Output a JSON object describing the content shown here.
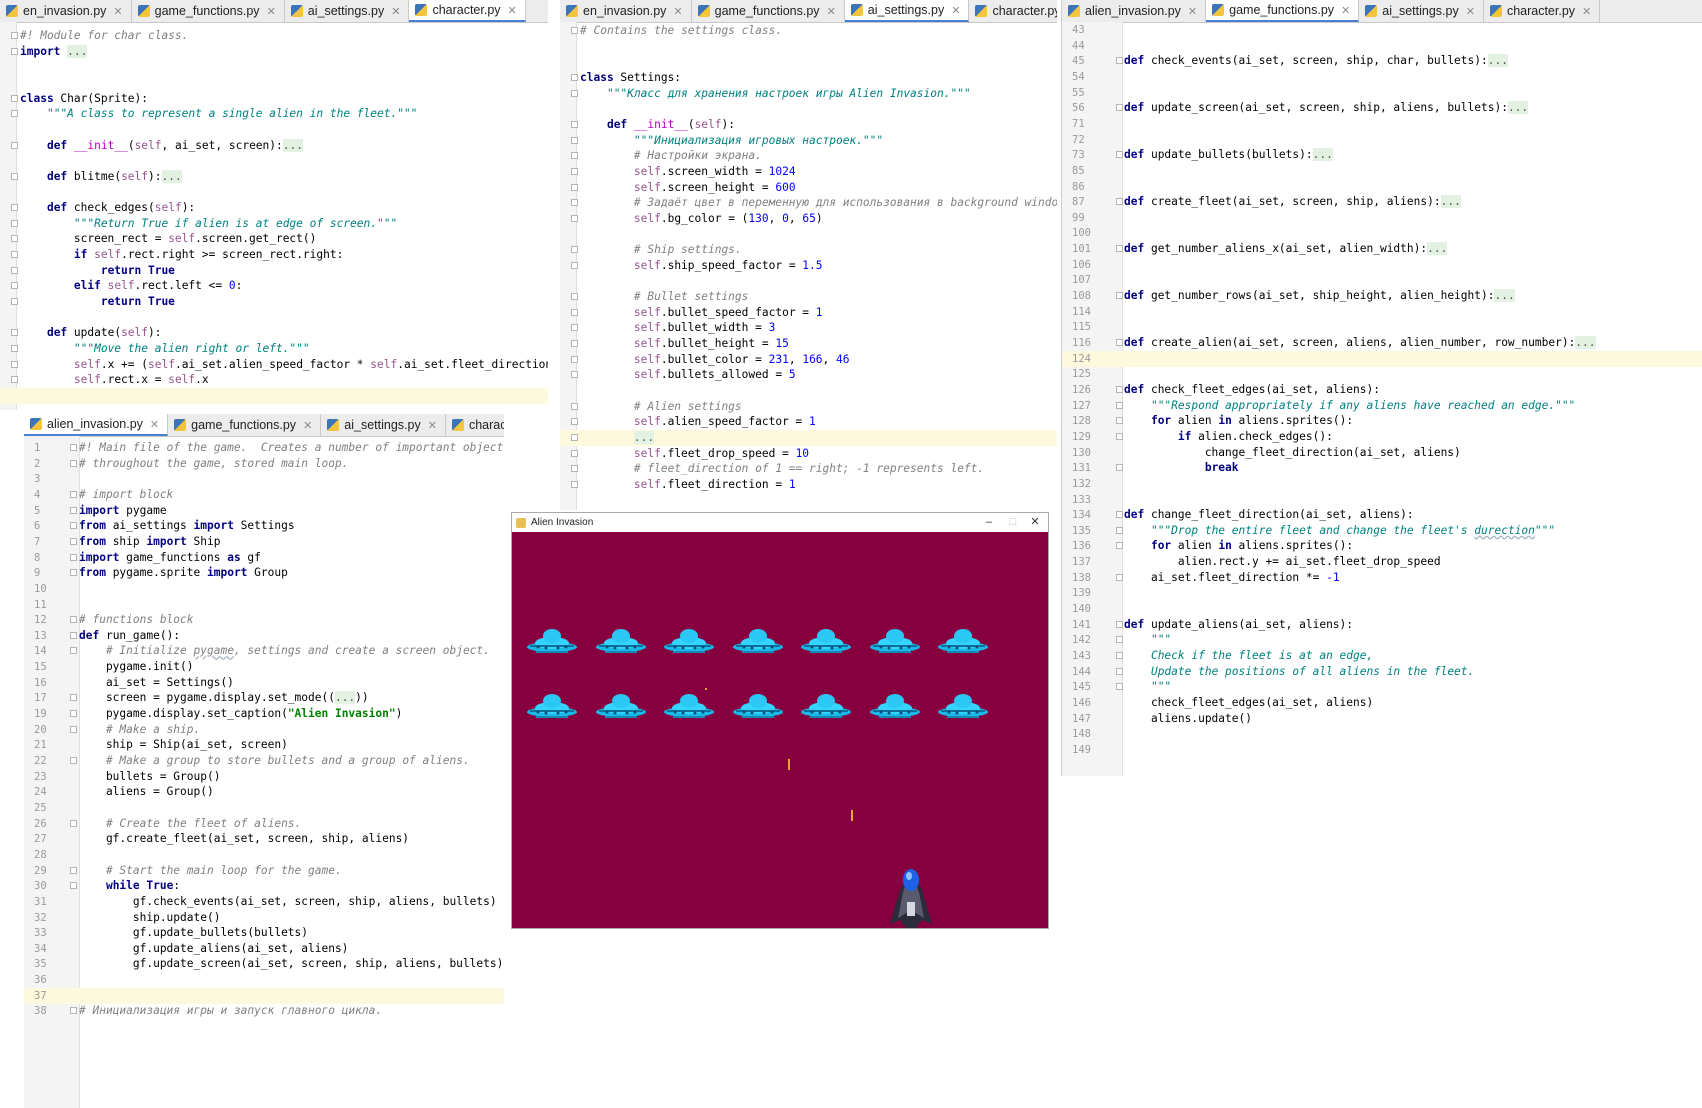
{
  "editor1": {
    "tabs": [
      {
        "label": "en_invasion.py",
        "active": false
      },
      {
        "label": "game_functions.py",
        "active": false
      },
      {
        "label": "ai_settings.py",
        "active": false
      },
      {
        "label": "character.py",
        "active": true
      }
    ],
    "lines": [
      {
        "t": "<span class='c'>#! Module for char class.</span>"
      },
      {
        "t": "<span class='k'>import</span> <span class='el'>...</span>"
      },
      {
        "t": ""
      },
      {
        "t": ""
      },
      {
        "t": "<span class='k'>class</span> Char(Sprite):"
      },
      {
        "t": "    <span class='s'>\"\"\"A class to represent a single alien in the fleet.\"\"\"</span>"
      },
      {
        "t": ""
      },
      {
        "t": "    <span class='k'>def</span> <span class='fn'>__init__</span>(<span class='sf'>self</span>, ai_set, screen):<span class='el'>...</span>"
      },
      {
        "t": ""
      },
      {
        "t": "    <span class='k'>def</span> blitme(<span class='sf'>self</span>):<span class='el'>...</span>"
      },
      {
        "t": ""
      },
      {
        "t": "    <span class='k'>def</span> check_edges(<span class='sf'>self</span>):"
      },
      {
        "t": "        <span class='s'>\"\"\"Return True if alien is at edge of screen.\"\"\"</span>"
      },
      {
        "t": "        screen_rect = <span class='sf'>self</span>.screen.get_rect()"
      },
      {
        "t": "        <span class='k'>if</span> <span class='sf'>self</span>.rect.right >= screen_rect.right:"
      },
      {
        "t": "            <span class='k'>return True</span>"
      },
      {
        "t": "        <span class='k'>elif</span> <span class='sf'>self</span>.rect.left <= <span class='n'>0</span>:"
      },
      {
        "t": "            <span class='k'>return True</span>"
      },
      {
        "t": ""
      },
      {
        "t": "    <span class='k'>def</span> update(<span class='sf'>self</span>):"
      },
      {
        "t": "        <span class='s'>\"\"\"Move the alien right or left.\"\"\"</span>"
      },
      {
        "t": "        <span class='sf'>self</span>.x += (<span class='sf'>self</span>.ai_set.alien_speed_factor * <span class='sf'>self</span>.ai_set.fleet_direction)"
      },
      {
        "t": "        <span class='sf'>self</span>.rect.x = <span class='sf'>self</span>.x"
      },
      {
        "t": "",
        "cur": true
      }
    ]
  },
  "editor2": {
    "tabs": [
      {
        "label": "en_invasion.py",
        "active": false
      },
      {
        "label": "game_functions.py",
        "active": false
      },
      {
        "label": "ai_settings.py",
        "active": true
      },
      {
        "label": "character.py",
        "active": false
      }
    ],
    "lines": [
      {
        "t": "<span class='c'># Contains the settings class.</span>"
      },
      {
        "t": ""
      },
      {
        "t": ""
      },
      {
        "t": "<span class='k'>class</span> Settings:"
      },
      {
        "t": "    <span class='s'>\"\"\"Класс для хранения настроек игры Alien Invasion.\"\"\"</span>"
      },
      {
        "t": ""
      },
      {
        "t": "    <span class='k'>def</span> <span class='fn'>__init__</span>(<span class='sf'>self</span>):"
      },
      {
        "t": "        <span class='s'>\"\"\"Инициализация игровых настроек.\"\"\"</span>"
      },
      {
        "t": "        <span class='c'># Настройки экрана.</span>"
      },
      {
        "t": "        <span class='sf'>self</span>.screen_width = <span class='n'>1024</span>"
      },
      {
        "t": "        <span class='sf'>self</span>.screen_height = <span class='n'>600</span>"
      },
      {
        "t": "        <span class='c'># Задаёт цвет в переменную для использования в background window.</span>"
      },
      {
        "t": "        <span class='sf'>self</span>.bg_color = (<span class='n'>130</span>, <span class='n'>0</span>, <span class='n'>65</span>)"
      },
      {
        "t": ""
      },
      {
        "t": "        <span class='c'># Ship settings.</span>"
      },
      {
        "t": "        <span class='sf'>self</span>.ship_speed_factor = <span class='n'>1.5</span>"
      },
      {
        "t": ""
      },
      {
        "t": "        <span class='c'># Bullet settings</span>"
      },
      {
        "t": "        <span class='sf'>self</span>.bullet_speed_factor = <span class='n'>1</span>"
      },
      {
        "t": "        <span class='sf'>self</span>.bullet_width = <span class='n'>3</span>"
      },
      {
        "t": "        <span class='sf'>self</span>.bullet_height = <span class='n'>15</span>"
      },
      {
        "t": "        <span class='sf'>self</span>.bullet_color = <span class='n'>231</span>, <span class='n'>166</span>, <span class='n'>46</span>"
      },
      {
        "t": "        <span class='sf'>self</span>.bullets_allowed = <span class='n'>5</span>"
      },
      {
        "t": ""
      },
      {
        "t": "        <span class='c'># Alien settings</span>"
      },
      {
        "t": "        <span class='sf'>self</span>.alien_speed_factor = <span class='n'>1</span>"
      },
      {
        "t": "        <span class='el'>...</span>",
        "cur": true
      },
      {
        "t": "        <span class='sf'>self</span>.fleet_drop_speed = <span class='n'>10</span>"
      },
      {
        "t": "        <span class='c'># fleet_direction of 1 == right; -1 represents left.</span>"
      },
      {
        "t": "        <span class='sf'>self</span>.fleet_direction = <span class='n'>1</span>"
      }
    ]
  },
  "editor3": {
    "tabs": [
      {
        "label": "alien_invasion.py",
        "active": false
      },
      {
        "label": "game_functions.py",
        "active": true
      },
      {
        "label": "ai_settings.py",
        "active": false
      },
      {
        "label": "character.py",
        "active": false
      }
    ],
    "lines": [
      {
        "n": "43",
        "t": ""
      },
      {
        "n": "44",
        "t": ""
      },
      {
        "n": "45",
        "t": "<span class='k'>def</span> check_events(ai_set, screen, ship, char, bullets):<span class='el'>...</span>"
      },
      {
        "n": "54",
        "t": ""
      },
      {
        "n": "55",
        "t": ""
      },
      {
        "n": "56",
        "t": "<span class='k'>def</span> update_screen(ai_set, screen, ship, aliens, bullets):<span class='el'>...</span>"
      },
      {
        "n": "71",
        "t": ""
      },
      {
        "n": "72",
        "t": ""
      },
      {
        "n": "73",
        "t": "<span class='k'>def</span> update_bullets(bullets):<span class='el'>...</span>"
      },
      {
        "n": "85",
        "t": ""
      },
      {
        "n": "86",
        "t": ""
      },
      {
        "n": "87",
        "t": "<span class='k'>def</span> create_fleet(ai_set, screen, ship, aliens):<span class='el'>...</span>"
      },
      {
        "n": "99",
        "t": ""
      },
      {
        "n": "100",
        "t": ""
      },
      {
        "n": "101",
        "t": "<span class='k'>def</span> get_number_aliens_x(ai_set, alien_width):<span class='el'>...</span>"
      },
      {
        "n": "106",
        "t": ""
      },
      {
        "n": "107",
        "t": ""
      },
      {
        "n": "108",
        "t": "<span class='k'>def</span> get_number_rows(ai_set, ship_height, alien_height):<span class='el'>...</span>"
      },
      {
        "n": "114",
        "t": ""
      },
      {
        "n": "115",
        "t": ""
      },
      {
        "n": "116",
        "t": "<span class='k'>def</span> create_alien(ai_set, screen, aliens, alien_number, row_number):<span class='el'>...</span>"
      },
      {
        "n": "124",
        "t": "",
        "cur": true
      },
      {
        "n": "125",
        "t": ""
      },
      {
        "n": "126",
        "t": "<span class='k'>def</span> check_fleet_edges(ai_set, aliens):"
      },
      {
        "n": "127",
        "t": "    <span class='s'>\"\"\"Respond appropriately if any aliens have reached an edge.\"\"\"</span>"
      },
      {
        "n": "128",
        "t": "    <span class='k'>for</span> alien <span class='k'>in</span> aliens.sprites():"
      },
      {
        "n": "129",
        "t": "        <span class='k'>if</span> alien.check_edges():"
      },
      {
        "n": "130",
        "t": "            change_fleet_direction(ai_set, aliens)"
      },
      {
        "n": "131",
        "t": "            <span class='k'>break</span>"
      },
      {
        "n": "132",
        "t": ""
      },
      {
        "n": "133",
        "t": ""
      },
      {
        "n": "134",
        "t": "<span class='k'>def</span> change_fleet_direction(ai_set, aliens):"
      },
      {
        "n": "135",
        "t": "    <span class='s'>\"\"\"Drop the entire fleet and change the fleet's <span class='ul'>durection</span>\"\"\"</span>"
      },
      {
        "n": "136",
        "t": "    <span class='k'>for</span> alien <span class='k'>in</span> aliens.sprites():"
      },
      {
        "n": "137",
        "t": "        alien.rect.y += ai_set.fleet_drop_speed"
      },
      {
        "n": "138",
        "t": "    ai_set.fleet_direction *= <span class='n'>-1</span>"
      },
      {
        "n": "139",
        "t": ""
      },
      {
        "n": "140",
        "t": ""
      },
      {
        "n": "141",
        "t": "<span class='k'>def</span> update_aliens(ai_set, aliens):"
      },
      {
        "n": "142",
        "t": "    <span class='s'>\"\"\"</span>"
      },
      {
        "n": "143",
        "t": "    <span class='s'>Check if the fleet is at an edge,</span>"
      },
      {
        "n": "144",
        "t": "    <span class='s'>Update the positions of all aliens in the fleet.</span>"
      },
      {
        "n": "145",
        "t": "    <span class='s'>\"\"\"</span>"
      },
      {
        "n": "146",
        "t": "    check_fleet_edges(ai_set, aliens)"
      },
      {
        "n": "147",
        "t": "    aliens.update()"
      },
      {
        "n": "148",
        "t": ""
      },
      {
        "n": "149",
        "t": ""
      }
    ]
  },
  "editor4": {
    "tabs": [
      {
        "label": "alien_invasion.py",
        "active": true
      },
      {
        "label": "game_functions.py",
        "active": false
      },
      {
        "label": "ai_settings.py",
        "active": false
      },
      {
        "label": "character.py",
        "active": false
      }
    ],
    "lines": [
      {
        "n": "1",
        "t": "<span class='c'>#! Main file of the game.  Creates a number of important objects u</span>"
      },
      {
        "n": "2",
        "t": "<span class='c'># throughout the game, stored main loop.</span>"
      },
      {
        "n": "3",
        "t": ""
      },
      {
        "n": "4",
        "t": "<span class='c'># import block</span>"
      },
      {
        "n": "5",
        "t": "<span class='k'>import</span> pygame"
      },
      {
        "n": "6",
        "t": "<span class='k'>from</span> ai_settings <span class='k'>import</span> Settings"
      },
      {
        "n": "7",
        "t": "<span class='k'>from</span> ship <span class='k'>import</span> Ship"
      },
      {
        "n": "8",
        "t": "<span class='k'>import</span> game_functions <span class='k'>as</span> gf"
      },
      {
        "n": "9",
        "t": "<span class='k'>from</span> pygame.sprite <span class='k'>import</span> Group"
      },
      {
        "n": "10",
        "t": ""
      },
      {
        "n": "11",
        "t": ""
      },
      {
        "n": "12",
        "t": "<span class='c'># functions block</span>"
      },
      {
        "n": "13",
        "t": "<span class='k'>def</span> run_game():"
      },
      {
        "n": "14",
        "t": "    <span class='c'># Initialize <span class='ul'>pygame</span>, settings and create a screen object.</span>"
      },
      {
        "n": "15",
        "t": "    pygame.init()"
      },
      {
        "n": "16",
        "t": "    ai_set = Settings()"
      },
      {
        "n": "17",
        "t": "    screen = pygame.display.set_mode((<span class='el'>...</span>))"
      },
      {
        "n": "19",
        "t": "    pygame.display.set_caption(<span class='str'>\"Alien Invasion\"</span>)"
      },
      {
        "n": "20",
        "t": "    <span class='c'># Make a ship.</span>"
      },
      {
        "n": "21",
        "t": "    ship = Ship(ai_set, screen)"
      },
      {
        "n": "22",
        "t": "    <span class='c'># Make a group to store bullets and a group of aliens.</span>"
      },
      {
        "n": "23",
        "t": "    bullets = Group()"
      },
      {
        "n": "24",
        "t": "    aliens = Group()"
      },
      {
        "n": "25",
        "t": ""
      },
      {
        "n": "26",
        "t": "    <span class='c'># Create the fleet of aliens.</span>"
      },
      {
        "n": "27",
        "t": "    gf.create_fleet(ai_set, screen, ship, aliens)"
      },
      {
        "n": "28",
        "t": ""
      },
      {
        "n": "29",
        "t": "    <span class='c'># Start the main loop for the game.</span>"
      },
      {
        "n": "30",
        "t": "    <span class='k'>while True</span>:"
      },
      {
        "n": "31",
        "t": "        gf.check_events(ai_set, screen, ship, aliens, bullets)"
      },
      {
        "n": "32",
        "t": "        ship.update()"
      },
      {
        "n": "33",
        "t": "        gf.update_bullets(bullets)"
      },
      {
        "n": "34",
        "t": "        gf.update_aliens(ai_set, aliens)"
      },
      {
        "n": "35",
        "t": "        gf.update_screen(ai_set, screen, ship, aliens, bullets)"
      },
      {
        "n": "36",
        "t": ""
      },
      {
        "n": "37",
        "t": "",
        "cur": true
      },
      {
        "n": "38",
        "t": "<span class='c'># Инициализация игры и запуск главного цикла.</span>"
      }
    ]
  },
  "game": {
    "title": "Alien Invasion",
    "min_label": "–",
    "max_label": "□",
    "close_label": "✕",
    "bg_color": "#860040",
    "alien_rows": 2,
    "aliens_per_row": 7
  }
}
